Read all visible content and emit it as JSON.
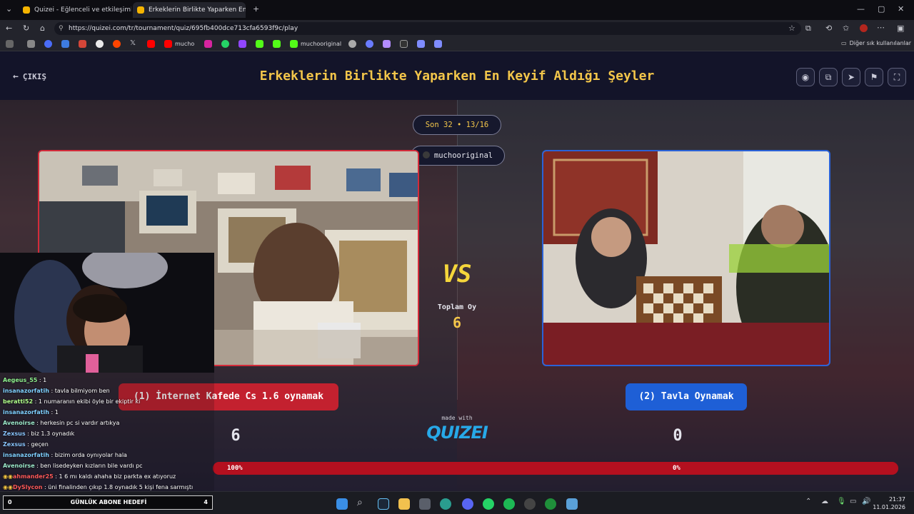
{
  "browser": {
    "tabs": [
      {
        "label": "Quizei - Eğlenceli ve etkileşimli qu",
        "active": false
      },
      {
        "label": "Erkeklerin Birlikte Yaparken En Key",
        "active": true
      }
    ],
    "url": "https://quizei.com/tr/tournament/quiz/695fb400dce713cfa6593f9c/play",
    "bookmarks": [
      "mucho",
      "muchooriginal"
    ],
    "other_bookmarks": "Diğer sık kullanılanlar"
  },
  "header": {
    "exit_label": "ÇIKIŞ",
    "title": "Erkeklerin Birlikte Yaparken En Keyif Aldığı Şeyler",
    "buttons": [
      "eye-icon",
      "copy-icon",
      "share-icon",
      "flag-icon",
      "fullscreen-icon"
    ]
  },
  "round": {
    "label": "Son 32 • 13/16",
    "host": "muchooriginal"
  },
  "center": {
    "vs": "VS",
    "total_label": "Toplam Oy",
    "total_value": "6",
    "made_with": "made with",
    "logo": "QUIZEI"
  },
  "options": [
    {
      "label": "(1) İnternet Kafede Cs 1.6 oynamak",
      "score": "6",
      "percent_label": "100%",
      "share": 1.0,
      "color": "#c3212f"
    },
    {
      "label": "(2) Tavla Oynamak",
      "score": "0",
      "percent_label": "0%",
      "share": 0.0,
      "color": "#1e5fd6"
    }
  ],
  "chat": [
    {
      "user": "Aegeus_55",
      "text": " : 1",
      "color": "#8ef08e"
    },
    {
      "user": "insanazorfatih",
      "text": " : tavla bilmiyom ben",
      "color": "#7fd0ff"
    },
    {
      "user": "beratti52",
      "text": " : 1 numaranın ekibi öyle bir ekiptir ki",
      "color": "#b0ff8a"
    },
    {
      "user": "insanazorfatih",
      "text": " : 1",
      "color": "#7fd0ff"
    },
    {
      "user": "Avenoirse",
      "text": " : herkesin pc si vardır artıkya",
      "color": "#9ae6c8"
    },
    {
      "user": "Zexsus",
      "text": " : biz 1.3 oynadık",
      "color": "#8ac6ff"
    },
    {
      "user": "Zexsus",
      "text": " : geçen",
      "color": "#8ac6ff"
    },
    {
      "user": "insanazorfatih",
      "text": " : bizim orda oynıyolar hala",
      "color": "#7fd0ff"
    },
    {
      "user": "Avenoirse",
      "text": " : ben lisedeyken kızların bile vardı pc",
      "color": "#9ae6c8"
    },
    {
      "user": "ahmander25",
      "text": " : 1 6 mı kaldı ahaha biz parkta ex atıyoruz",
      "color": "#ff5a5a"
    },
    {
      "user": "DySlycon",
      "text": " : üni finalinden çıkıp 1.8 oynadık 5 kişi fena sarmıştı",
      "color": "#ff5a5a"
    }
  ],
  "goal": {
    "left": "0",
    "label": "GÜNLÜK ABONE HEDEFİ",
    "right": "4"
  },
  "taskbar": {
    "time": "21:37",
    "date": "11.01.2026"
  }
}
